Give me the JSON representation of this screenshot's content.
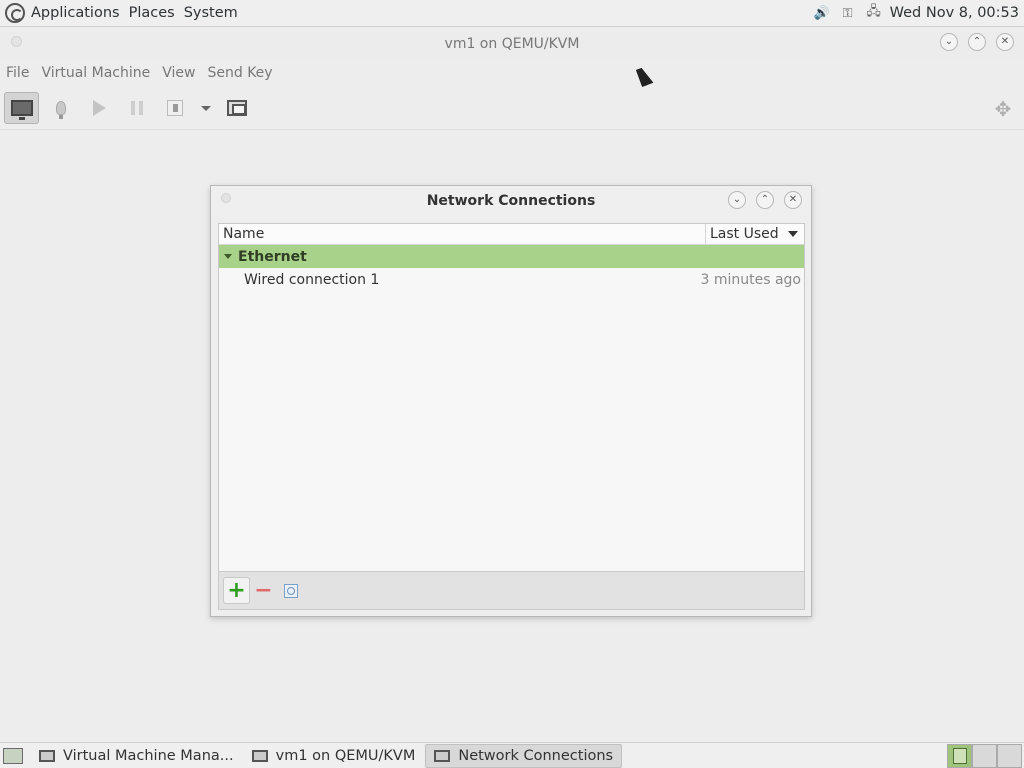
{
  "top_panel": {
    "menus": [
      "Applications",
      "Places",
      "System"
    ],
    "clock": "Wed Nov  8, 00:53"
  },
  "vm_window": {
    "title": "vm1 on QEMU/KVM",
    "menus": [
      "File",
      "Virtual Machine",
      "View",
      "Send Key"
    ]
  },
  "dialog": {
    "title": "Network Connections",
    "columns": {
      "name": "Name",
      "last_used": "Last Used"
    },
    "groups": [
      {
        "label": "Ethernet",
        "connections": [
          {
            "name": "Wired connection 1",
            "last_used": "3 minutes ago"
          }
        ]
      }
    ]
  },
  "taskbar": {
    "tasks": [
      "Virtual Machine Mana...",
      "vm1 on QEMU/KVM",
      "Network Connections"
    ]
  },
  "colors": {
    "group_highlight": "#a8d28a",
    "add_green": "#2f9c1f",
    "remove_red": "#e06a6a"
  }
}
